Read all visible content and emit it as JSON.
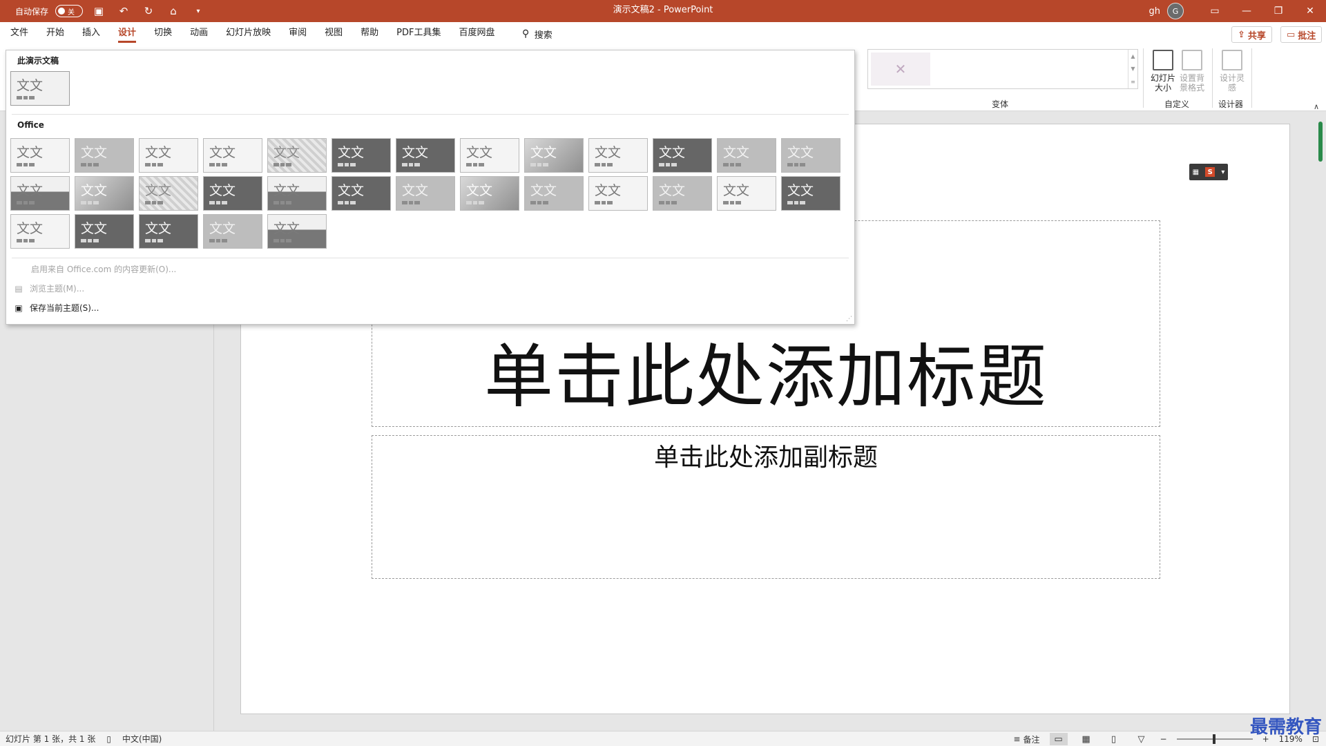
{
  "titlebar": {
    "autosave_label": "自动保存",
    "autosave_state": "关",
    "title": "演示文稿2  -  PowerPoint",
    "user": "gh",
    "avatar_initial": "G"
  },
  "menu": {
    "tabs": [
      "文件",
      "开始",
      "插入",
      "设计",
      "切换",
      "动画",
      "幻灯片放映",
      "审阅",
      "视图",
      "帮助",
      "PDF工具集",
      "百度网盘"
    ],
    "active_index": 3,
    "search_label": "搜索",
    "share_label": "共享",
    "comment_label": "批注"
  },
  "ribbon": {
    "variants_label": "变体",
    "customize_label": "自定义",
    "designer_label": "设计器",
    "slide_size_label": "幻灯片大小",
    "format_bg_label": "设置背景格式",
    "design_ideas_label": "设计灵感"
  },
  "theme_panel": {
    "this_presentation_heading": "此演示文稿",
    "office_heading": "Office",
    "sample_text": "文文",
    "theme_styles": [
      "light",
      "mid",
      "light",
      "light",
      "pattern",
      "dark",
      "dark",
      "light",
      "gradient",
      "light",
      "dark",
      "mid",
      "mid",
      "band",
      "gradient",
      "pattern",
      "dark",
      "band",
      "dark",
      "mid",
      "gradient",
      "mid",
      "light",
      "mid",
      "light",
      "dark",
      "light",
      "dark",
      "dark",
      "mid",
      "band"
    ],
    "enable_updates": "启用来自 Office.com 的内容更新(O)...",
    "browse_themes": "浏览主题(M)...",
    "save_theme": "保存当前主题(S)..."
  },
  "slide": {
    "title_placeholder": "单击此处添加标题",
    "subtitle_placeholder": "单击此处添加副标题"
  },
  "statusbar": {
    "slide_info": "幻灯片 第 1 张，共 1 张",
    "language": "中文(中国)",
    "notes_label": "备注",
    "zoom": "119%"
  },
  "watermark": "最需教育"
}
